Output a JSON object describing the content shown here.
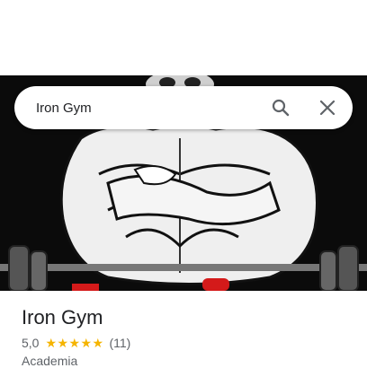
{
  "search": {
    "value": "Iron Gym"
  },
  "place": {
    "name": "Iron Gym",
    "rating": "5,0",
    "star_count": 5,
    "review_count": "(11)",
    "category": "Academia"
  },
  "icons": {
    "search": "search-icon",
    "close": "close-icon",
    "star": "star-icon"
  },
  "colors": {
    "star": "#f5b400",
    "title": "#202124",
    "secondary": "#5f6368"
  }
}
